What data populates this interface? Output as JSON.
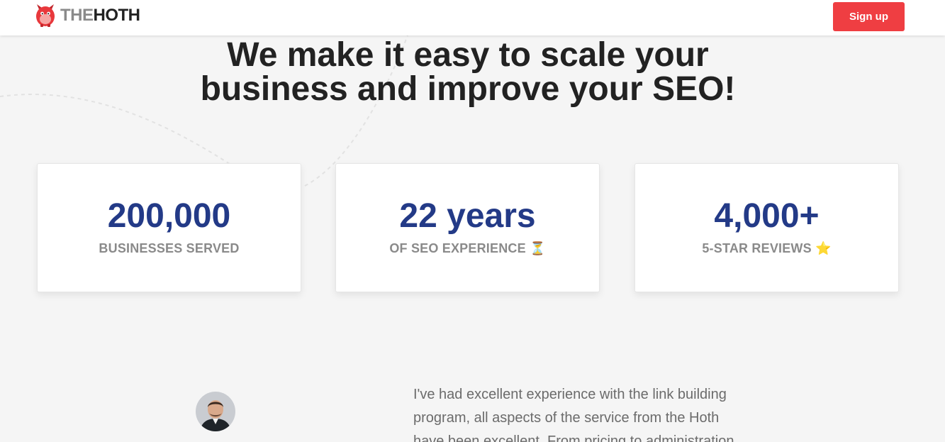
{
  "header": {
    "logo": {
      "the": "THE",
      "hoth": "HOTH",
      "icon": "hoth-mascot-icon"
    },
    "signup_label": "Sign up"
  },
  "hero": {
    "title_line1": "We make it easy to scale your",
    "title_line2": "business and improve your SEO!"
  },
  "stats": [
    {
      "value": "200,000",
      "label": "BUSINESSES SERVED"
    },
    {
      "value": "22 years",
      "label": "OF SEO EXPERIENCE ⏳"
    },
    {
      "value": "4,000+",
      "label": "5-STAR REVIEWS ⭐"
    }
  ],
  "testimonial": {
    "text": "I've had excellent experience with the link building program, all aspects of the service from the Hoth have been excellent. From pricing to administration"
  },
  "colors": {
    "accent": "#ef3e42",
    "stat_value": "#233a87",
    "stat_label": "#8a8a8a",
    "heading": "#222222",
    "background": "#f5f5f5"
  }
}
